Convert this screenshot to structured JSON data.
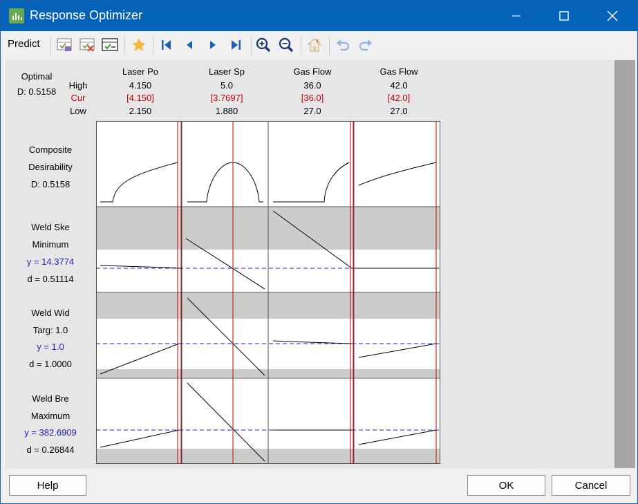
{
  "window": {
    "title": "Response Optimizer"
  },
  "toolbar": {
    "predict_label": "Predict"
  },
  "header": {
    "optimal_label": "Optimal",
    "d_value": "D: 0.5158",
    "row_labels": {
      "high": "High",
      "cur": "Cur",
      "low": "Low"
    },
    "factors": [
      {
        "name": "Laser Po",
        "high": "4.150",
        "cur": "[4.150]",
        "low": "2.150"
      },
      {
        "name": "Laser Sp",
        "high": "5.0",
        "cur": "[3.7697]",
        "low": "1.880"
      },
      {
        "name": "Gas Flow",
        "high": "36.0",
        "cur": "[36.0]",
        "low": "27.0"
      },
      {
        "name": "Gas Flow",
        "high": "42.0",
        "cur": "[42.0]",
        "low": "27.0"
      }
    ]
  },
  "rows": [
    {
      "line1": "Composite",
      "line2": "Desirability",
      "line3": "D: 0.5158",
      "line4": ""
    },
    {
      "line1": "Weld Ske",
      "line2": "Minimum",
      "line3": "y = 14.3774",
      "line4": "d = 0.51114"
    },
    {
      "line1": "Weld Wid",
      "line2": "Targ: 1.0",
      "line3": "y = 1.0",
      "line4": "d = 1.0000"
    },
    {
      "line1": "Weld Bre",
      "line2": "Maximum",
      "line3": "y = 382.6909",
      "line4": "d = 0.26844"
    }
  ],
  "buttons": {
    "help": "Help",
    "ok": "OK",
    "cancel": "Cancel"
  },
  "colors": {
    "titlebar": "#0463b8",
    "current": "#c00000",
    "response": "#1f1fbf",
    "band": "#cccccc"
  }
}
